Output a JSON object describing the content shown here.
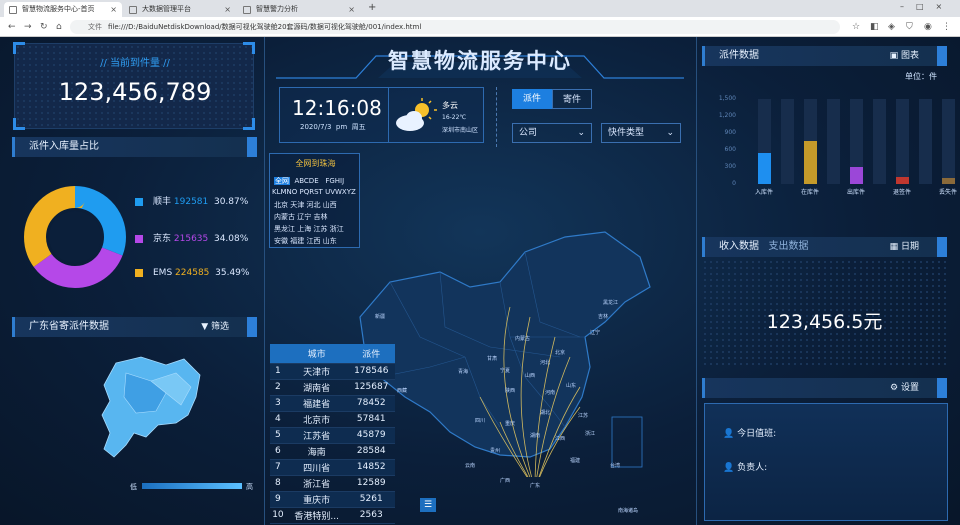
{
  "browser": {
    "tabs": [
      "智慧物流服务中心-首页",
      "大数据管理平台",
      "智慧警力分析"
    ],
    "address_prefix": "文件",
    "address": "file:///D:/BaiduNetdiskDownload/数据可视化驾驶舱20套源码/数据可视化驾驶舱/001/index.html"
  },
  "header": {
    "title": "智慧物流服务中心"
  },
  "left": {
    "today_count_title": "当前到件量",
    "today_count_value": "123,456,789",
    "share_title": "派件入库量占比",
    "legend": [
      {
        "name": "顺丰",
        "value": "192581",
        "pct": "30.87%",
        "color": "#1f9cf0"
      },
      {
        "name": "京东",
        "value": "215635",
        "pct": "34.08%",
        "color": "#b548e8"
      },
      {
        "name": "EMS",
        "value": "224585",
        "pct": "35.49%",
        "color": "#f0b020"
      }
    ],
    "gd_title": "广东省寄派件数据",
    "gd_filter": "筛选",
    "scale_low": "低",
    "scale_high": "高"
  },
  "center": {
    "time": "12:16:08",
    "date": "2020/7/3",
    "ampm": "pm",
    "weekday": "周五",
    "weather": "多云",
    "temp": "16-22℃",
    "location": "深圳市南山区",
    "tabs": [
      "派件",
      "寄件"
    ],
    "select_company": "公司",
    "select_type": "快件类型",
    "nation_title": "全网到珠海",
    "letter_rows": [
      [
        "全网",
        "ABCDE",
        "FGHIJ"
      ],
      [
        "KLMNO",
        "PQRST",
        "UVWXYZ"
      ],
      [
        "北京",
        "天津",
        "河北",
        "山西"
      ],
      [
        "内蒙古",
        "辽宁",
        "吉林"
      ],
      [
        "黑龙江",
        "上海",
        "江苏",
        "浙江"
      ],
      [
        "安徽",
        "福建",
        "江西",
        "山东"
      ]
    ],
    "table_headers": [
      "城市",
      "派件"
    ],
    "table_rows": [
      [
        "1",
        "天津市",
        "178546"
      ],
      [
        "2",
        "湖南省",
        "125687"
      ],
      [
        "3",
        "福建省",
        "78452"
      ],
      [
        "4",
        "北京市",
        "57841"
      ],
      [
        "5",
        "江苏省",
        "45879"
      ],
      [
        "6",
        "海南",
        "28584"
      ],
      [
        "7",
        "四川省",
        "14852"
      ],
      [
        "8",
        "浙江省",
        "12589"
      ],
      [
        "9",
        "重庆市",
        "5261"
      ],
      [
        "10",
        "香港特别...",
        "2563"
      ]
    ],
    "map_labels": [
      {
        "t": "新疆"
      },
      {
        "t": "西藏"
      },
      {
        "t": "青海"
      },
      {
        "t": "甘肃"
      },
      {
        "t": "四川"
      },
      {
        "t": "云南"
      },
      {
        "t": "内蒙古"
      },
      {
        "t": "黑龙江"
      },
      {
        "t": "吉林"
      },
      {
        "t": "辽宁"
      },
      {
        "t": "北京"
      },
      {
        "t": "河北"
      },
      {
        "t": "山西"
      },
      {
        "t": "陕西"
      },
      {
        "t": "河南"
      },
      {
        "t": "山东"
      },
      {
        "t": "江苏"
      },
      {
        "t": "湖北"
      },
      {
        "t": "湖南"
      },
      {
        "t": "江西"
      },
      {
        "t": "浙江"
      },
      {
        "t": "福建"
      },
      {
        "t": "广东"
      },
      {
        "t": "广西"
      },
      {
        "t": "贵州"
      },
      {
        "t": "重庆"
      },
      {
        "t": "宁夏"
      },
      {
        "t": "台湾"
      },
      {
        "t": "南海诸岛"
      }
    ]
  },
  "right": {
    "dispatch_title": "派件数据",
    "chart_btn": "图表",
    "unit": "单位：件",
    "income_title": "收入数据",
    "expense_title": "支出数据",
    "date_btn": "日期",
    "amount": "123,456.5元",
    "settings": "设置",
    "duty_today": "今日值班:",
    "owner": "负责人:"
  },
  "chart_data": {
    "type": "bar",
    "categories": [
      "入库件",
      "在库件",
      "出库件",
      "退签件",
      "丢失件"
    ],
    "values": [
      540,
      750,
      300,
      130,
      110
    ],
    "ylim": [
      0,
      1500
    ],
    "yticks": [
      "1,500",
      "1,200",
      "900",
      "600",
      "300",
      "0"
    ],
    "colors": [
      "#1e8ff0",
      "#c49a2a",
      "#9b47d8",
      "#c0372f",
      "#8a6a3a"
    ]
  }
}
